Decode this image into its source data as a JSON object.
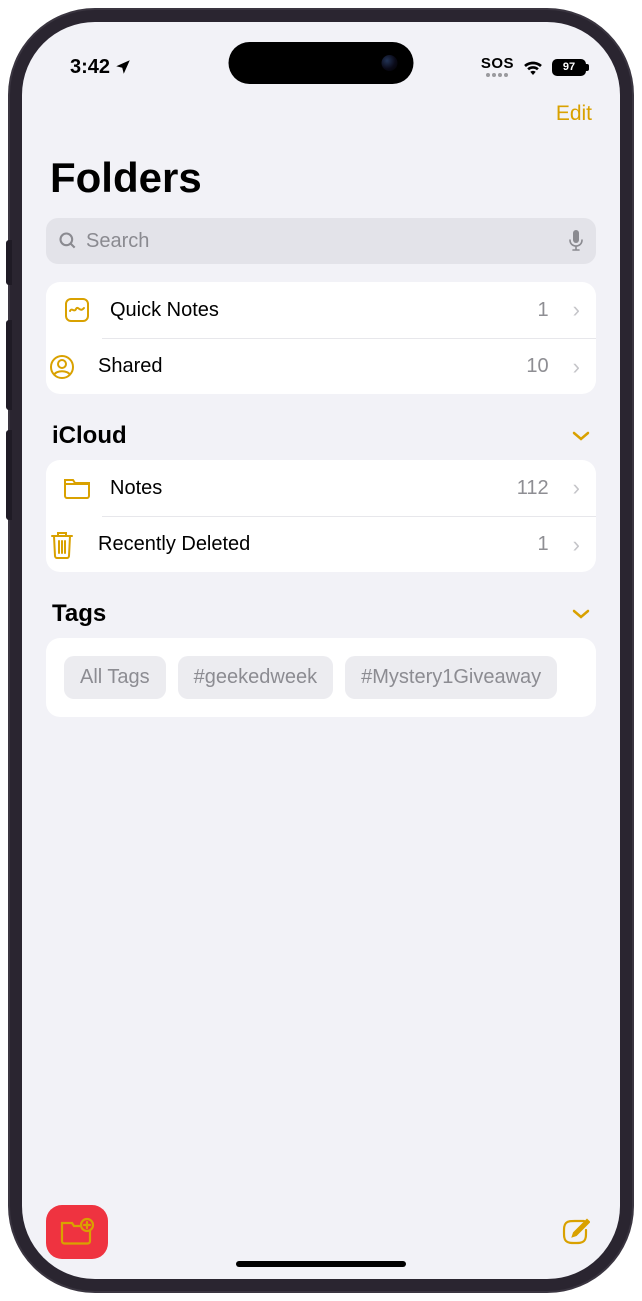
{
  "status": {
    "time": "3:42",
    "sos": "SOS",
    "battery": "97"
  },
  "nav": {
    "edit": "Edit"
  },
  "page_title": "Folders",
  "search": {
    "placeholder": "Search"
  },
  "top_folders": [
    {
      "label": "Quick Notes",
      "count": "1",
      "icon": "quicknote"
    },
    {
      "label": "Shared",
      "count": "10",
      "icon": "shared"
    }
  ],
  "sections": {
    "icloud": {
      "title": "iCloud",
      "folders": [
        {
          "label": "Notes",
          "count": "112",
          "icon": "folder"
        },
        {
          "label": "Recently Deleted",
          "count": "1",
          "icon": "trash"
        }
      ]
    },
    "tags": {
      "title": "Tags",
      "items": [
        "All Tags",
        "#geekedweek",
        "#Mystery1Giveaway"
      ]
    }
  },
  "colors": {
    "accent": "#d9a100",
    "highlight": "#ef3340"
  }
}
